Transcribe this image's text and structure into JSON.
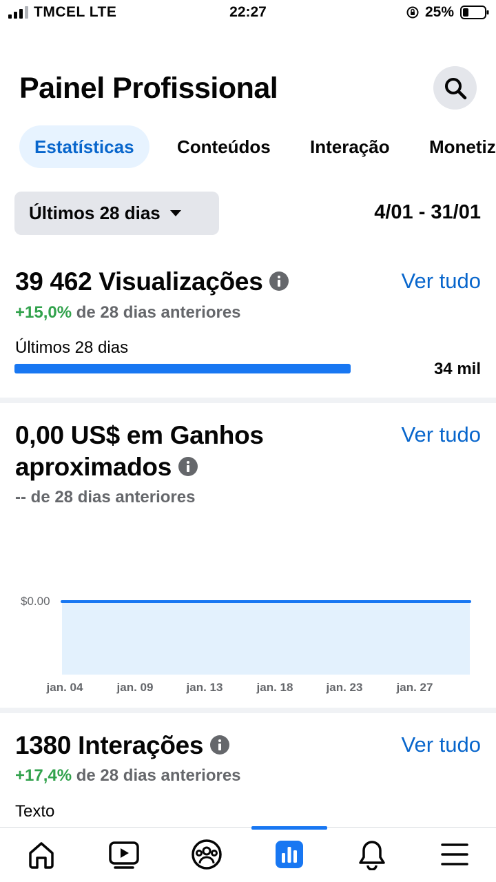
{
  "status_bar": {
    "carrier": "TMCEL  LTE",
    "time": "22:27",
    "battery": "25%"
  },
  "header": {
    "title": "Painel Profissional",
    "search_icon": "search-icon"
  },
  "tabs": [
    {
      "label": "Estatísticas",
      "active": true
    },
    {
      "label": "Conteúdos",
      "active": false
    },
    {
      "label": "Interação",
      "active": false
    },
    {
      "label": "Monetização",
      "active": false
    }
  ],
  "filter": {
    "period": "Últimos 28 dias",
    "date_range": "4/01 - 31/01"
  },
  "views_card": {
    "title": "39 462 Visualizações",
    "see_all": "Ver tudo",
    "change": "+15,0%",
    "compare_text": "de 28 dias anteriores",
    "bar_label": "Últimos 28 dias",
    "bar_value": "34 mil",
    "bar_fraction": 0.72
  },
  "earnings_card": {
    "title_line1": "0,00 US$ em Ganhos",
    "title_line2": "aproximados",
    "see_all": "Ver tudo",
    "compare_text": "-- de 28 dias anteriores"
  },
  "chart_data": {
    "type": "area",
    "x": [
      "jan. 04",
      "jan. 09",
      "jan. 13",
      "jan. 18",
      "jan. 23",
      "jan. 27"
    ],
    "y_ticks": [
      "$0.00"
    ],
    "series": [
      {
        "values": [
          0,
          0,
          0,
          0,
          0,
          0
        ]
      }
    ],
    "ylim": [
      0,
      0
    ],
    "line_color": "#1877f2",
    "fill_color": "#e3f1fd"
  },
  "interactions_card": {
    "title": "1380 Interações",
    "see_all": "Ver tudo",
    "change": "+17,4%",
    "compare_text": "de 28 dias anteriores",
    "bar_label": "Texto"
  },
  "bottom_nav": [
    {
      "icon": "home-icon",
      "active": false
    },
    {
      "icon": "video-icon",
      "active": false
    },
    {
      "icon": "groups-icon",
      "active": false
    },
    {
      "icon": "dashboard-icon",
      "active": true
    },
    {
      "icon": "bell-icon",
      "active": false
    },
    {
      "icon": "menu-icon",
      "active": false
    }
  ],
  "colors": {
    "accent": "#1877f2",
    "link": "#0866cc",
    "positive": "#31a24c",
    "muted": "#65676b"
  }
}
